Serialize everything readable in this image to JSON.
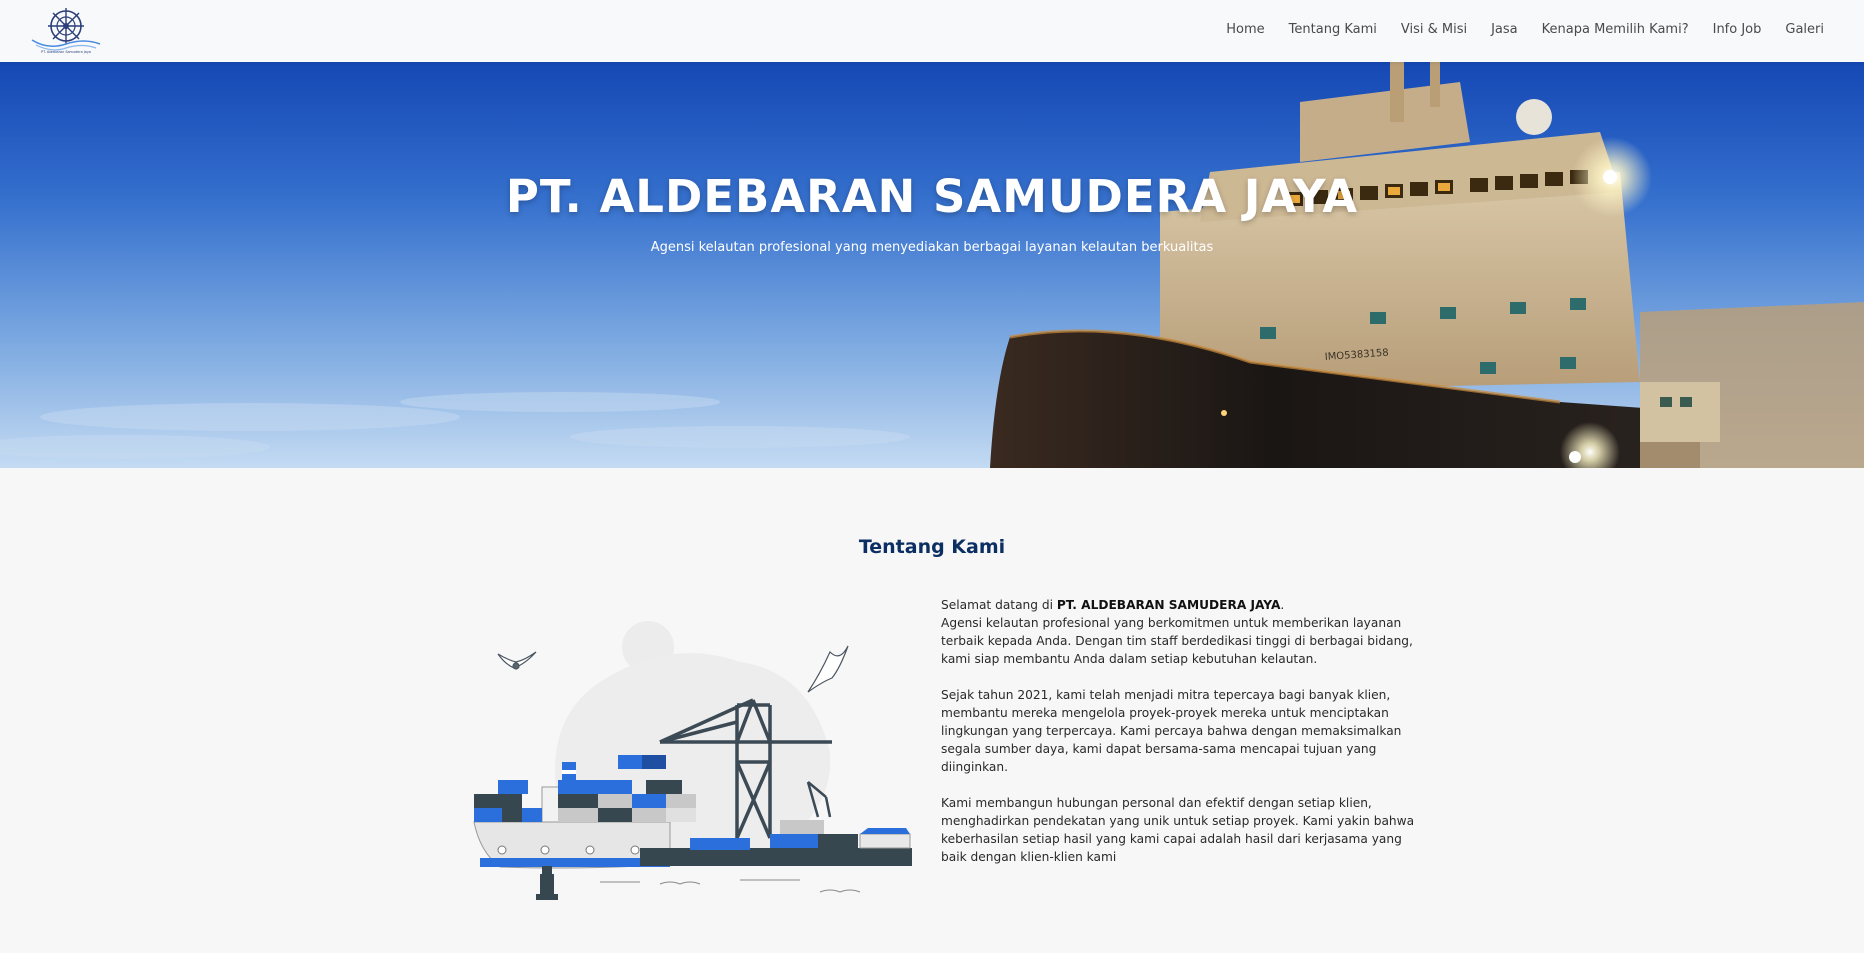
{
  "brand": {
    "logo_caption": "PT. Aldebaran Samudera Jaya"
  },
  "nav": {
    "items": [
      {
        "label": "Home"
      },
      {
        "label": "Tentang Kami"
      },
      {
        "label": "Visi & Misi"
      },
      {
        "label": "Jasa"
      },
      {
        "label": "Kenapa Memilih Kami?"
      },
      {
        "label": "Info Job"
      },
      {
        "label": "Galeri"
      }
    ]
  },
  "hero": {
    "title": "PT. ALDEBARAN SAMUDERA JAYA",
    "subtitle": "Agensi kelautan profesional yang menyediakan berbagai layanan kelautan berkualitas",
    "ship_marking": "IMO5383158"
  },
  "about": {
    "title": "Tentang Kami",
    "welcome_prefix": "Selamat datang di ",
    "company_name": "PT. ALDEBARAN SAMUDERA JAYA",
    "welcome_suffix": ".",
    "paragraph1": "Agensi kelautan profesional yang berkomitmen untuk memberikan layanan terbaik kepada Anda. Dengan tim staff berdedikasi tinggi di berbagai bidang, kami siap membantu Anda dalam setiap kebutuhan kelautan.",
    "paragraph2": "Sejak tahun 2021, kami telah menjadi mitra tepercaya bagi banyak klien, membantu mereka mengelola proyek-proyek mereka untuk menciptakan lingkungan yang terpercaya. Kami percaya bahwa dengan memaksimalkan segala sumber daya, kami dapat bersama-sama mencapai tujuan yang diinginkan.",
    "paragraph3": "Kami membangun hubungan personal dan efektif dengan setiap klien, menghadirkan pendekatan yang unik untuk setiap proyek. Kami yakin bahwa keberhasilan setiap hasil yang kami capai adalah hasil dari kerjasama yang baik dengan klien-klien kami"
  },
  "colors": {
    "navy": "#0b2e63",
    "container_blue": "#2a6fdc",
    "hull_dark": "#37474f"
  }
}
